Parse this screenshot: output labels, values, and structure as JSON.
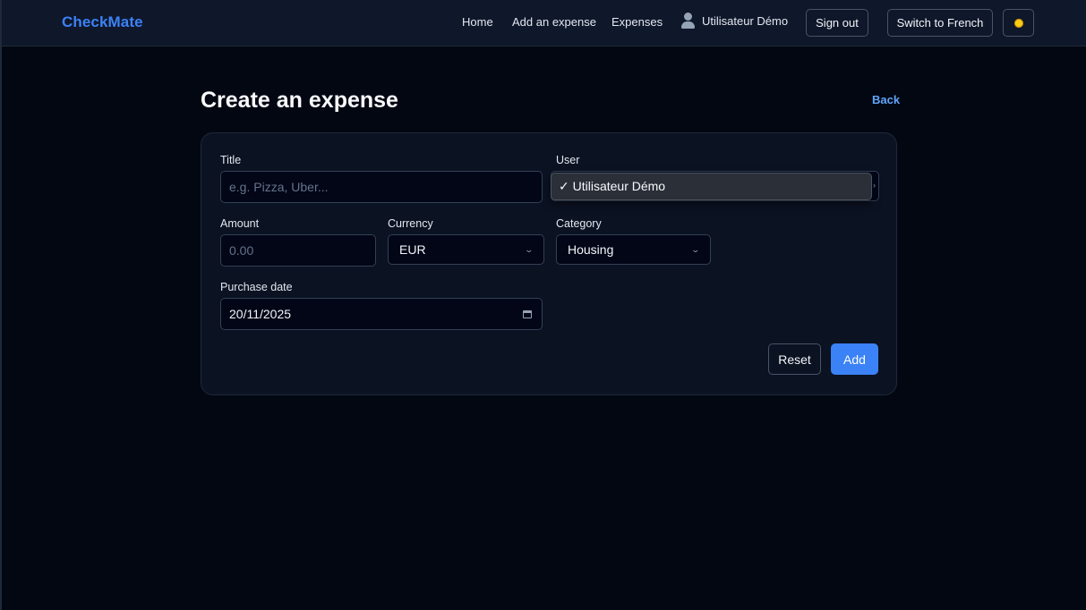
{
  "navbar": {
    "brand": "CheckMate",
    "links": {
      "home": "Home",
      "add_expense": "Add an expense",
      "expenses": "Expenses"
    },
    "user_name": "Utilisateur Démo",
    "sign_out": "Sign out",
    "switch_language": "Switch to French",
    "theme_icon": "sun-icon"
  },
  "header": {
    "title": "Create an expense",
    "back": "Back"
  },
  "form": {
    "title": {
      "label": "Title",
      "placeholder": "e.g. Pizza, Uber..."
    },
    "user": {
      "label": "User",
      "selected_option": "✓ Utilisateur Démo"
    },
    "amount": {
      "label": "Amount",
      "placeholder": "0.00"
    },
    "currency": {
      "label": "Currency",
      "value": "EUR"
    },
    "category": {
      "label": "Category",
      "value": "Housing"
    },
    "purchase_date": {
      "label": "Purchase date",
      "value": "20/11/2025"
    },
    "reset": "Reset",
    "add": "Add"
  },
  "colors": {
    "accent": "#3b82f6",
    "background": "#030712",
    "card": "#0b1222"
  }
}
